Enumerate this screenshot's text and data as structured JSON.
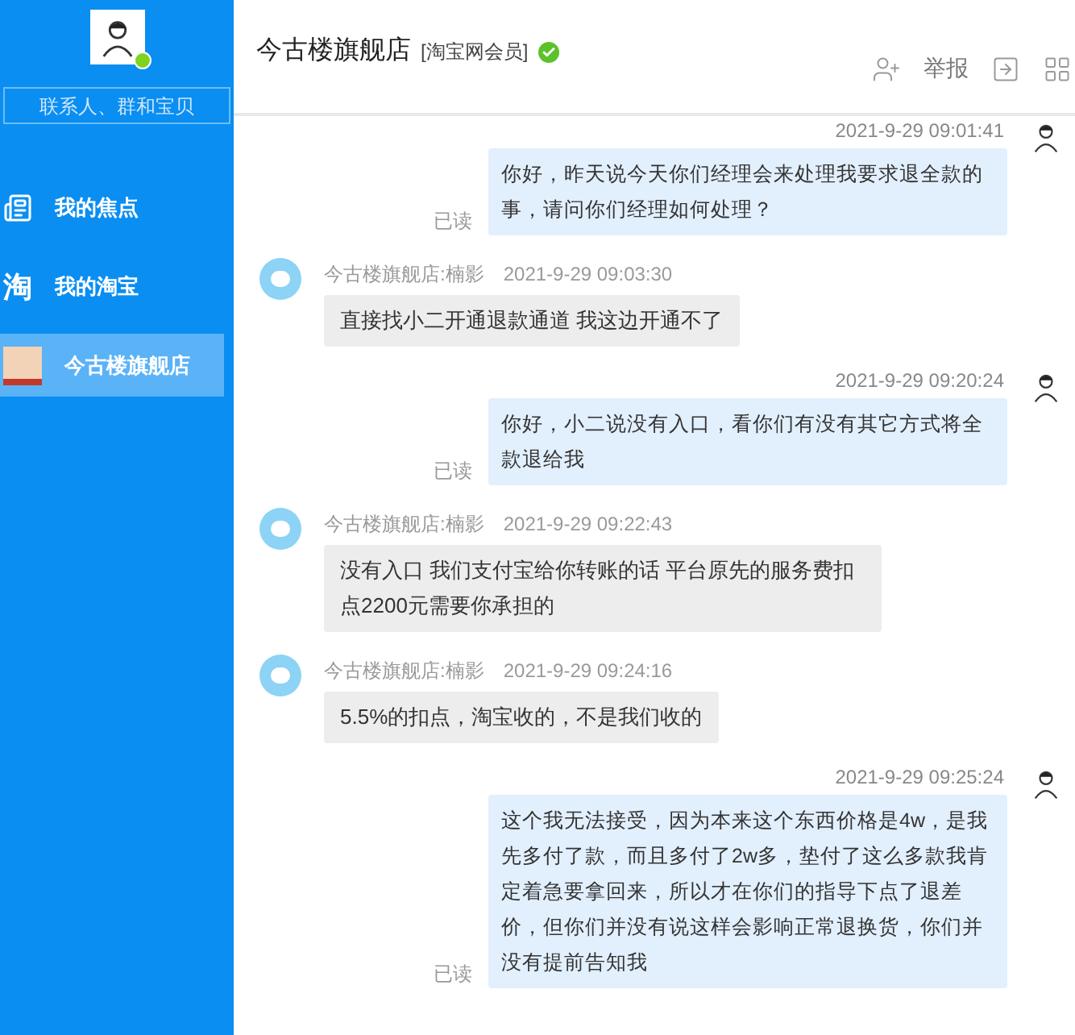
{
  "sidebar": {
    "search": {
      "placeholder": "联系人、群和宝贝"
    },
    "items": [
      {
        "kind": "focus",
        "label": "我的焦点",
        "selected": false
      },
      {
        "kind": "taobao",
        "icon_text": "淘",
        "label": "我的淘宝",
        "selected": false
      },
      {
        "kind": "shop",
        "label": "今古楼旗舰店",
        "selected": true
      }
    ]
  },
  "header": {
    "title": "今古楼旗舰店",
    "badge": "[淘宝网会员]",
    "verified": true,
    "report": "举报"
  },
  "messages": [
    {
      "kind": "sent",
      "time": "2021-9-29 09:01:41",
      "text": "你好，昨天说今天你们经理会来处理我要求退全款的事，请问你们经理如何处理？",
      "status": "已读"
    },
    {
      "kind": "received",
      "sender": "今古楼旗舰店:楠影",
      "time": "2021-9-29 09:03:30",
      "text": "直接找小二开通退款通道  我这边开通不了"
    },
    {
      "kind": "sent",
      "time": "2021-9-29 09:20:24",
      "text": "你好，小二说没有入口，看你们有没有其它方式将全款退给我",
      "status": "已读"
    },
    {
      "kind": "received",
      "sender": "今古楼旗舰店:楠影",
      "time": "2021-9-29 09:22:43",
      "text": "没有入口  我们支付宝给你转账的话 平台原先的服务费扣点2200元需要你承担的"
    },
    {
      "kind": "received",
      "sender": "今古楼旗舰店:楠影",
      "time": "2021-9-29 09:24:16",
      "text": "5.5%的扣点，淘宝收的，不是我们收的"
    },
    {
      "kind": "sent",
      "time": "2021-9-29 09:25:24",
      "text": "这个我无法接受，因为本来这个东西价格是4w，是我先多付了款，而且多付了2w多，垫付了这么多款我肯定着急要拿回来，所以才在你们的指导下点了退差价，但你们并没有说这样会影响正常退换货，你们并没有提前告知我",
      "status": "已读"
    }
  ]
}
